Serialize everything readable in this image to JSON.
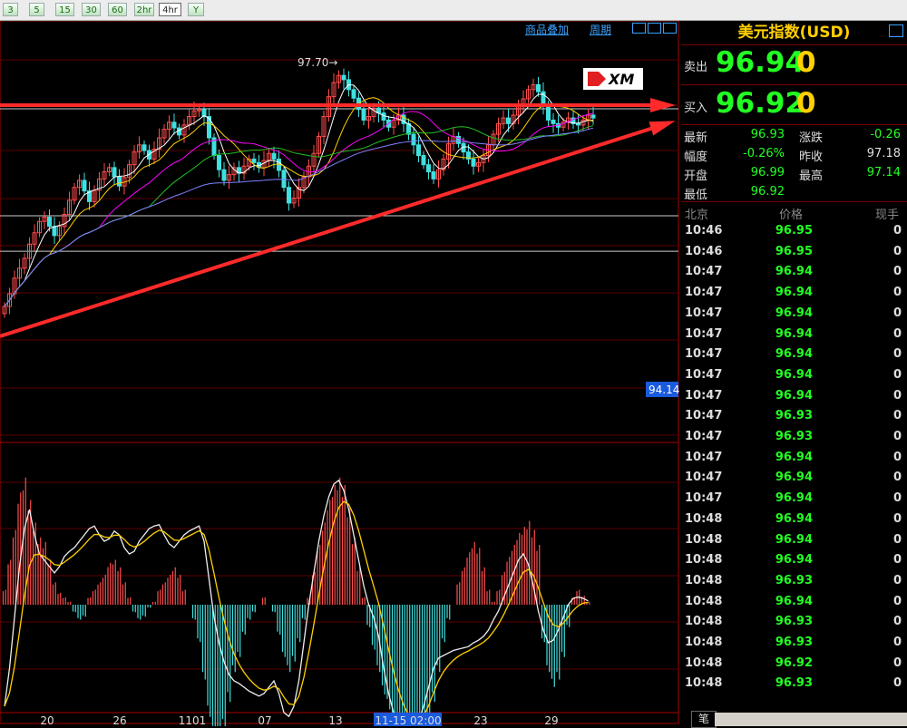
{
  "toolbar": {
    "buttons": [
      "3",
      "5",
      "15",
      "30",
      "60",
      "2hr",
      "4hr",
      "Y"
    ],
    "active": "4hr"
  },
  "menu": {
    "overlay": "商品叠加",
    "period": "周期"
  },
  "quote": {
    "title": "美元指数(USD)",
    "sell_label": "卖出",
    "sell_price": "96.94",
    "sell_vol": "0",
    "buy_label": "买入",
    "buy_price": "96.92",
    "buy_vol": "0",
    "stats": [
      {
        "label": "最新",
        "value": "96.93",
        "color": "#22ff22"
      },
      {
        "label": "涨跌",
        "value": "-0.26",
        "color": "#22ff22"
      },
      {
        "label": "幅度",
        "value": "-0.26%",
        "color": "#22ff22"
      },
      {
        "label": "昨收",
        "value": "97.18",
        "color": "#dddddd"
      },
      {
        "label": "开盘",
        "value": "96.99",
        "color": "#22ff22"
      },
      {
        "label": "最高",
        "value": "97.14",
        "color": "#22ff22"
      },
      {
        "label": "最低",
        "value": "96.92",
        "color": "#22ff22"
      }
    ],
    "tick_headers": {
      "time": "北京",
      "price": "价格",
      "volume": "现手"
    },
    "ticks": [
      {
        "time": "10:46",
        "price": "96.95",
        "vol": "0"
      },
      {
        "time": "10:46",
        "price": "96.95",
        "vol": "0"
      },
      {
        "time": "10:47",
        "price": "96.94",
        "vol": "0"
      },
      {
        "time": "10:47",
        "price": "96.94",
        "vol": "0"
      },
      {
        "time": "10:47",
        "price": "96.94",
        "vol": "0"
      },
      {
        "time": "10:47",
        "price": "96.94",
        "vol": "0"
      },
      {
        "time": "10:47",
        "price": "96.94",
        "vol": "0"
      },
      {
        "time": "10:47",
        "price": "96.94",
        "vol": "0"
      },
      {
        "time": "10:47",
        "price": "96.94",
        "vol": "0"
      },
      {
        "time": "10:47",
        "price": "96.93",
        "vol": "0"
      },
      {
        "time": "10:47",
        "price": "96.93",
        "vol": "0"
      },
      {
        "time": "10:47",
        "price": "96.94",
        "vol": "0"
      },
      {
        "time": "10:47",
        "price": "96.94",
        "vol": "0"
      },
      {
        "time": "10:47",
        "price": "96.94",
        "vol": "0"
      },
      {
        "time": "10:48",
        "price": "96.94",
        "vol": "0"
      },
      {
        "time": "10:48",
        "price": "96.94",
        "vol": "0"
      },
      {
        "time": "10:48",
        "price": "96.94",
        "vol": "0"
      },
      {
        "time": "10:48",
        "price": "96.93",
        "vol": "0"
      },
      {
        "time": "10:48",
        "price": "96.94",
        "vol": "0"
      },
      {
        "time": "10:48",
        "price": "96.93",
        "vol": "0"
      },
      {
        "time": "10:48",
        "price": "96.93",
        "vol": "0"
      },
      {
        "time": "10:48",
        "price": "96.92",
        "vol": "0"
      },
      {
        "time": "10:48",
        "price": "96.93",
        "vol": "0"
      }
    ],
    "bottom_tab": "笔"
  },
  "chart_data": {
    "type": "candlestick",
    "x_tick_labels": [
      "20",
      "26",
      "1101",
      "07",
      "13",
      "11-15 02:00",
      "23",
      "29"
    ],
    "price_annotations": {
      "high_marker": "97.70",
      "cursor_value": "94.14"
    },
    "logo_text": "XM",
    "ohlc_close": [
      94.42,
      94.6,
      94.82,
      94.96,
      95.1,
      95.3,
      95.46,
      95.62,
      95.68,
      95.55,
      95.42,
      95.55,
      95.72,
      95.92,
      96.1,
      96.2,
      96.05,
      95.9,
      96.06,
      96.22,
      96.32,
      96.38,
      96.25,
      96.12,
      96.24,
      96.42,
      96.6,
      96.7,
      96.62,
      96.5,
      96.64,
      96.8,
      96.92,
      97.02,
      96.94,
      96.84,
      96.98,
      97.1,
      97.18,
      97.2,
      97.1,
      96.8,
      96.55,
      96.35,
      96.2,
      96.28,
      96.38,
      96.3,
      96.4,
      96.5,
      96.45,
      96.38,
      96.48,
      96.58,
      96.5,
      96.34,
      96.1,
      95.88,
      95.95,
      96.1,
      96.25,
      96.4,
      96.58,
      96.82,
      97.1,
      97.38,
      97.58,
      97.68,
      97.62,
      97.48,
      97.36,
      97.2,
      97.05,
      97.1,
      97.22,
      97.15,
      97.05,
      96.95,
      97.05,
      97.12,
      97.0,
      96.85,
      96.7,
      96.55,
      96.42,
      96.32,
      96.22,
      96.35,
      96.5,
      96.72,
      96.82,
      96.72,
      96.6,
      96.5,
      96.4,
      96.45,
      96.55,
      96.7,
      96.85,
      97.0,
      97.08,
      97.0,
      97.12,
      97.24,
      97.35,
      97.48,
      97.55,
      97.45,
      97.25,
      97.05,
      97.0,
      96.95,
      97.02,
      97.08,
      97.0,
      96.98,
      97.05,
      97.12,
      97.08
    ],
    "overlay_lines": "moving averages (yellow, magenta, green, blue)",
    "trendlines": [
      {
        "name": "resistance",
        "from": [
          0,
          97.26
        ],
        "to": [
          118,
          97.26
        ]
      },
      {
        "name": "support",
        "from": [
          0,
          94.0
        ],
        "to": [
          118,
          97.0
        ]
      }
    ],
    "horizontal_levels": [
      95.7,
      95.2
    ],
    "indicator": {
      "type": "macd",
      "histogram": [
        0.1,
        0.3,
        0.5,
        0.75,
        0.85,
        0.7,
        0.55,
        0.45,
        0.42,
        0.3,
        0.15,
        0.08,
        0.05,
        0.02,
        -0.05,
        -0.1,
        -0.08,
        0.05,
        0.1,
        0.15,
        0.2,
        0.28,
        0.3,
        0.25,
        0.15,
        0.05,
        -0.05,
        -0.1,
        -0.08,
        -0.02,
        0.02,
        0.1,
        0.15,
        0.2,
        0.25,
        0.2,
        0.1,
        0.0,
        -0.1,
        -0.25,
        -0.5,
        -0.75,
        -0.9,
        -0.95,
        -0.85,
        -0.65,
        -0.45,
        -0.35,
        -0.2,
        -0.1,
        -0.05,
        0.0,
        0.05,
        0.0,
        -0.05,
        -0.2,
        -0.35,
        -0.45,
        -0.38,
        -0.25,
        -0.1,
        0.05,
        0.22,
        0.4,
        0.55,
        0.7,
        0.8,
        0.85,
        0.8,
        0.65,
        0.45,
        0.25,
        0.05,
        -0.15,
        -0.3,
        -0.45,
        -0.6,
        -0.7,
        -0.8,
        -0.85,
        -0.9,
        -0.95,
        -0.98,
        -0.95,
        -0.9,
        -0.8,
        -0.65,
        -0.45,
        -0.25,
        -0.1,
        0.0,
        0.15,
        0.25,
        0.35,
        0.42,
        0.38,
        0.25,
        0.1,
        0.02,
        0.1,
        0.22,
        0.32,
        0.4,
        0.48,
        0.52,
        0.56,
        0.5,
        0.4,
        -0.25,
        -0.45,
        -0.55,
        -0.5,
        -0.35,
        -0.15,
        0.05,
        0.1,
        0.06,
        0.02
      ],
      "dif": [
        -0.8,
        -0.5,
        -0.1,
        0.3,
        0.6,
        0.75,
        0.55,
        0.4,
        0.35,
        0.3,
        0.25,
        0.3,
        0.38,
        0.42,
        0.45,
        0.5,
        0.55,
        0.6,
        0.62,
        0.55,
        0.5,
        0.52,
        0.58,
        0.55,
        0.45,
        0.4,
        0.42,
        0.5,
        0.55,
        0.6,
        0.62,
        0.63,
        0.55,
        0.48,
        0.45,
        0.5,
        0.55,
        0.58,
        0.6,
        0.62,
        0.5,
        0.2,
        -0.1,
        -0.3,
        -0.45,
        -0.55,
        -0.6,
        -0.62,
        -0.65,
        -0.68,
        -0.7,
        -0.72,
        -0.7,
        -0.65,
        -0.6,
        -0.7,
        -0.85,
        -0.88,
        -0.8,
        -0.6,
        -0.3,
        0.0,
        0.25,
        0.5,
        0.7,
        0.85,
        0.95,
        0.98,
        0.9,
        0.75,
        0.55,
        0.35,
        0.15,
        0.0,
        -0.1,
        -0.25,
        -0.5,
        -0.7,
        -0.85,
        -0.95,
        -1.0,
        -1.02,
        -1.0,
        -0.92,
        -0.8,
        -0.65,
        -0.5,
        -0.42,
        -0.4,
        -0.38,
        -0.36,
        -0.35,
        -0.34,
        -0.33,
        -0.3,
        -0.28,
        -0.25,
        -0.2,
        -0.12,
        -0.05,
        0.05,
        0.15,
        0.25,
        0.35,
        0.4,
        0.32,
        0.15,
        -0.05,
        -0.2,
        -0.3,
        -0.28,
        -0.2,
        -0.1,
        0.0,
        0.05,
        0.06,
        0.05,
        0.03
      ]
    }
  }
}
